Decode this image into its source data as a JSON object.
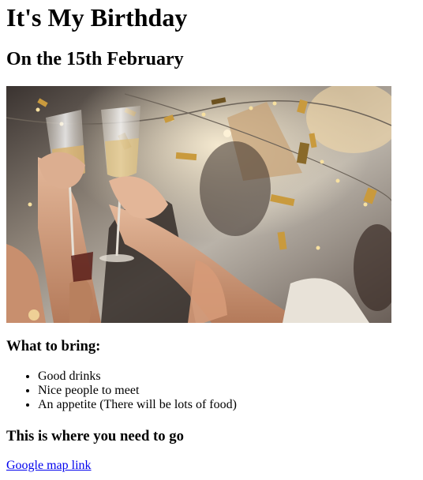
{
  "page": {
    "title": "It's My Birthday",
    "subtitle": "On the 15th February"
  },
  "photo": {
    "subject": "party-toast-photo"
  },
  "bring": {
    "heading": "What to bring:",
    "items": [
      "Good drinks",
      "Nice people to meet",
      "An appetite (There will be lots of food)"
    ]
  },
  "directions": {
    "heading": "This is where you need to go",
    "link_text": "Google map link"
  },
  "colors": {
    "link": "#0000ee",
    "text": "#000000",
    "background": "#ffffff"
  }
}
